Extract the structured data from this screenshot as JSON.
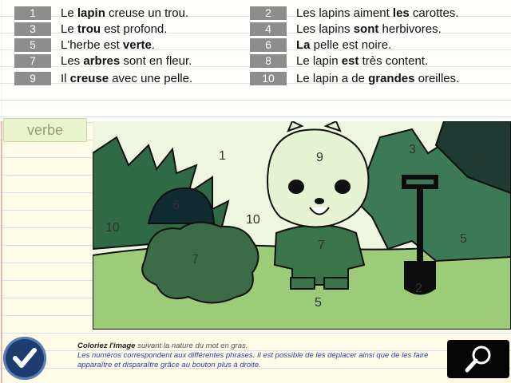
{
  "sentences": [
    {
      "num": "1",
      "before": "Le ",
      "bold": "lapin",
      "after": " creuse un trou."
    },
    {
      "num": "2",
      "before": "Les lapins aiment ",
      "bold": "les",
      "after": " carottes."
    },
    {
      "num": "3",
      "before": "Le ",
      "bold": "trou",
      "after": " est profond."
    },
    {
      "num": "4",
      "before": "Les lapins ",
      "bold": "sont",
      "after": " herbivores."
    },
    {
      "num": "5",
      "before": "L'herbe est ",
      "bold": "verte",
      "after": "."
    },
    {
      "num": "6",
      "before": "",
      "bold": "La",
      "after": " pelle est noire."
    },
    {
      "num": "7",
      "before": "Les ",
      "bold": "arbres",
      "after": " sont en fleur."
    },
    {
      "num": "8",
      "before": "Le lapin ",
      "bold": "est",
      "after": " très content."
    },
    {
      "num": "9",
      "before": "Il ",
      "bold": "creuse",
      "after": " avec une pelle."
    },
    {
      "num": "10",
      "before": "Le lapin a de ",
      "bold": "grandes",
      "after": " oreilles."
    }
  ],
  "category": {
    "label": "verbe",
    "color": "#eaf3cf"
  },
  "picture": {
    "region_numbers": [
      "1",
      "2",
      "3",
      "5",
      "6",
      "7",
      "7",
      "9",
      "10",
      "10",
      "2",
      "5"
    ]
  },
  "footer": {
    "instruction_title": "Coloriez l'image",
    "instruction_rest": " suivant la nature du mot en gras.",
    "instruction_help": "Les numéros correspondent aux différentes phrases. Il est possible de les déplacer ainsi que de les faire apparaître et disparaître grâce au bouton plus à droite."
  },
  "icons": {
    "validate": "checkmark-icon",
    "zoom": "magnifier-icon"
  },
  "colors": {
    "dark_green": "#2e5e3a",
    "mid_green": "#4f8a5a",
    "light_green": "#8fbf6e",
    "pale_green": "#d8ebc0",
    "black": "#0d0d0d"
  }
}
